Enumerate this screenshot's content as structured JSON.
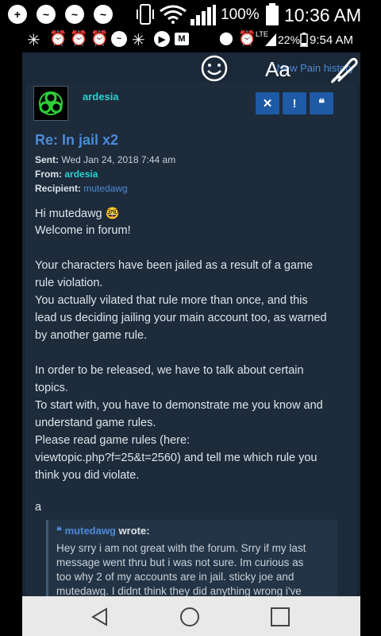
{
  "status_bar": {
    "battery_percent": "100%",
    "time": "10:36 AM",
    "battery_small": "22%",
    "time_small": "9:54 AM",
    "network_label": "LTE"
  },
  "overlay": {
    "aa_label": "Aa",
    "history_link": "New Pain history"
  },
  "post": {
    "author": "ardesia",
    "buttons": [
      "✕",
      "!",
      "❝"
    ],
    "subject": "Re: In jail x2",
    "sent_label": "Sent:",
    "sent_value": "Wed Jan 24, 2018 7:44 am",
    "from_label": "From:",
    "from_value": "ardesia",
    "recipient_label": "Recipient:",
    "recipient_value": "mutedawg",
    "body_lines": [
      "Hi mutedawg 🤓",
      "Welcome in forum!",
      "",
      "Your characters have been jailed as a result of a game",
      "rule violation.",
      "You actually vilated that rule more than once, and this",
      "lead us deciding jailing your main account too, as warned",
      "by another game rule.",
      "",
      "In order to be released, we have to talk about certain",
      "topics.",
      "To start with, you have to demonstrate me you know and",
      "understand game rules.",
      "Please read game rules (here:",
      "viewtopic.php?f=25&t=2560) and tell me which rule you",
      "think you did violate.",
      "",
      "a"
    ],
    "quote": {
      "author": "mutedawg",
      "wrote_label": "wrote:",
      "lines": [
        "Hey srry i am not great with the forum. Srry if my last",
        "message went thru but i was not sure. Im curious as",
        "too why 2 of my accounts are in jail. sticky joe and",
        "mutedawg. I didnt think they did anything wrong i've"
      ]
    }
  },
  "colors": {
    "link_blue": "#4c8bd6",
    "author_cyan": "#2bd1d1",
    "button_blue": "#1e5aa5",
    "background": "#172433"
  }
}
